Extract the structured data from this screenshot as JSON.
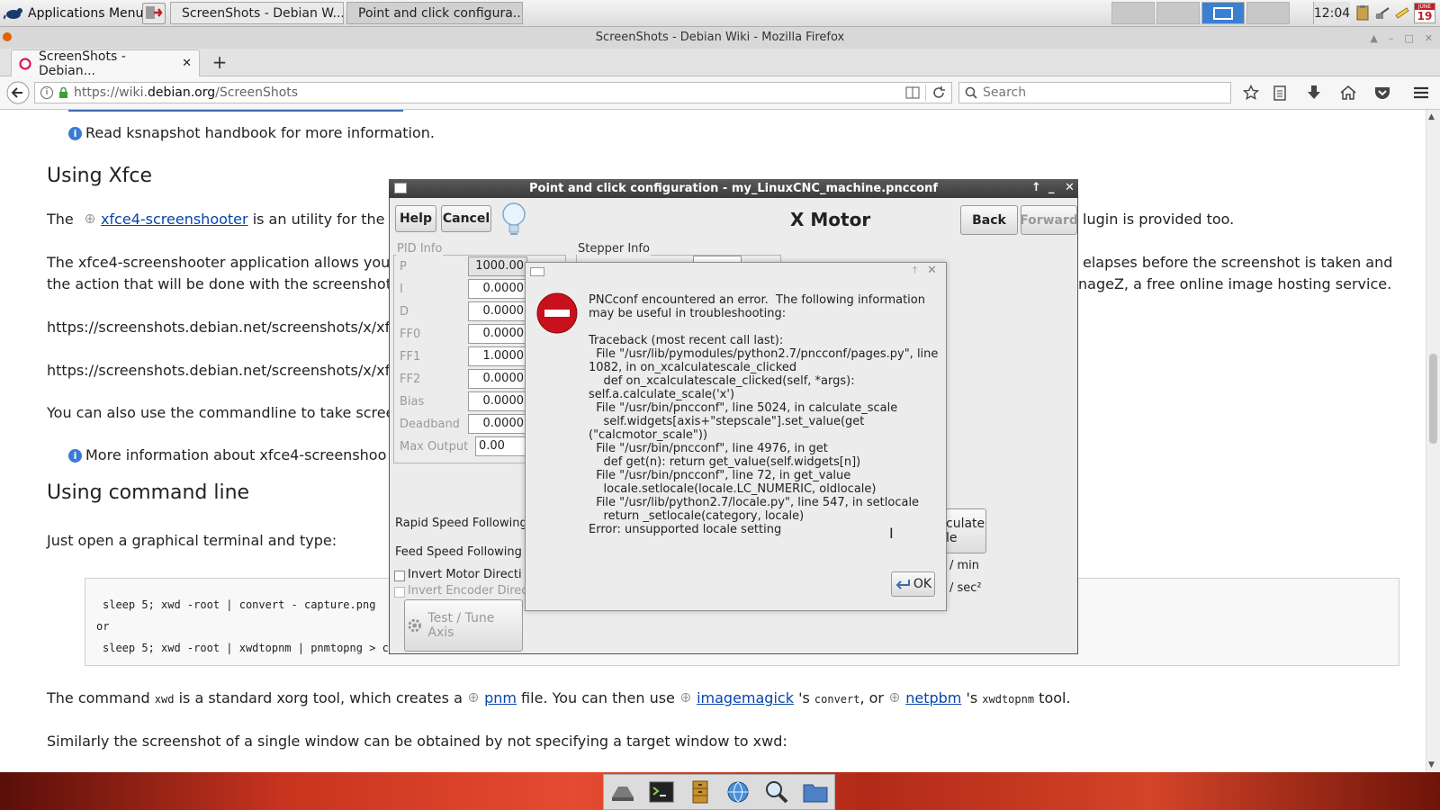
{
  "panel": {
    "apps_menu_label": "Applications Menu",
    "tasks": [
      {
        "label": "ScreenShots - Debian W..."
      },
      {
        "label": "Point and click configura..."
      }
    ],
    "clock": "12:04",
    "calendar_day": "19",
    "calendar_month": "JUNE"
  },
  "browser": {
    "window_title": "ScreenShots - Debian Wiki - Mozilla Firefox",
    "tab_label": "ScreenShots - Debian...",
    "new_tab": "+",
    "url_prefix": "https://wiki.",
    "url_domain": "debian.org",
    "url_path": "/ScreenShots",
    "search_placeholder": "Search"
  },
  "page": {
    "ksnapshot_info": "Read ksnapshot handbook for more information.",
    "h_xfce": "Using Xfce",
    "xfce_p1_pre": "The",
    "xfce_link": "xfce4-screenshooter",
    "xfce_p1_post": "is an utility for the X",
    "xfce_p1_tail": "lugin is provided too.",
    "xfce_p2_a": "The xfce4-screenshooter application allows you",
    "xfce_p2_a_tail": "elapses before the screenshot is taken and",
    "xfce_p2_b": "the action that will be done with the screenshot",
    "xfce_p2_b_tail": "nageZ, a free online image hosting service.",
    "url1": "https://screenshots.debian.net/screenshots/x/xfc",
    "url2": "https://screenshots.debian.net/screenshots/x/xfc",
    "cmdline_p": "You can also use the commandline to take scree",
    "more_info": "More information about xfce4-screenshoo",
    "h_cmd": "Using command line",
    "terminal_p": "Just open a graphical terminal and type:",
    "code1": "sleep 5; xwd -root | convert - capture.png",
    "code_or": "or",
    "code2": "sleep 5; xwd -root | xwdtopnm | pnmtopng > ca",
    "xwd_p_1": "The command",
    "xwd_p_cmd": "xwd",
    "xwd_p_2": "is a standard xorg tool, which creates a",
    "pnm_link": "pnm",
    "xwd_p_3": "file. You can then use",
    "imagemagick_link": "imagemagick",
    "xwd_p_4": "'s",
    "convert_cmd": "convert",
    "xwd_p_5": ", or",
    "netpbm_link": "netpbm",
    "xwd_p_6": "'s",
    "xwdtopnm_cmd": "xwdtopnm",
    "xwd_p_7": "tool.",
    "single_window_p": "Similarly the screenshot of a single window can be obtained by not specifying a target window to xwd:"
  },
  "pnc": {
    "title": "Point and click configuration - my_LinuxCNC_machine.pncconf",
    "help": "Help",
    "cancel": "Cancel",
    "heading": "X Motor",
    "back": "Back",
    "forward": "Forward",
    "pid_info": "PID Info",
    "stepper_info": "Stepper Info",
    "pid_rows": [
      {
        "label": "P",
        "value": "1000.00"
      },
      {
        "label": "I",
        "value": "0.0000"
      },
      {
        "label": "D",
        "value": "0.0000"
      },
      {
        "label": "FF0",
        "value": "0.0000"
      },
      {
        "label": "FF1",
        "value": "1.0000"
      },
      {
        "label": "FF2",
        "value": "0.0000"
      },
      {
        "label": "Bias",
        "value": "0.0000"
      },
      {
        "label": "Deadband",
        "value": "0.0000"
      }
    ],
    "max_output_label": "Max Output",
    "max_output_value": "0.00",
    "rapid_speed": "Rapid Speed Following",
    "feed_speed": "Feed Speed Following",
    "invert_motor": "Invert Motor Directi",
    "invert_encoder": "Invert Encoder Direc",
    "test_tune": "Test / Tune Axis",
    "calc_scale_1": "culate",
    "calc_scale_2": "le",
    "unit_min": "/ min",
    "unit_sec": "/ sec²"
  },
  "error_dialog": {
    "message": "PNCconf encountered an error.  The following information\nmay be useful in troubleshooting:\n\nTraceback (most recent call last):\n  File \"/usr/lib/pymodules/python2.7/pncconf/pages.py\", line\n1082, in on_xcalculatescale_clicked\n    def on_xcalculatescale_clicked(self, *args):\nself.a.calculate_scale('x')\n  File \"/usr/bin/pncconf\", line 5024, in calculate_scale\n    self.widgets[axis+\"stepscale\"].set_value(get\n(\"calcmotor_scale\"))\n  File \"/usr/bin/pncconf\", line 4976, in get\n    def get(n): return get_value(self.widgets[n])\n  File \"/usr/bin/pncconf\", line 72, in get_value\n    locale.setlocale(locale.LC_NUMERIC, oldlocale)\n  File \"/usr/lib/python2.7/locale.py\", line 547, in setlocale\n    return _setlocale(category, locale)\nError: unsupported locale setting",
    "ok": "OK"
  }
}
